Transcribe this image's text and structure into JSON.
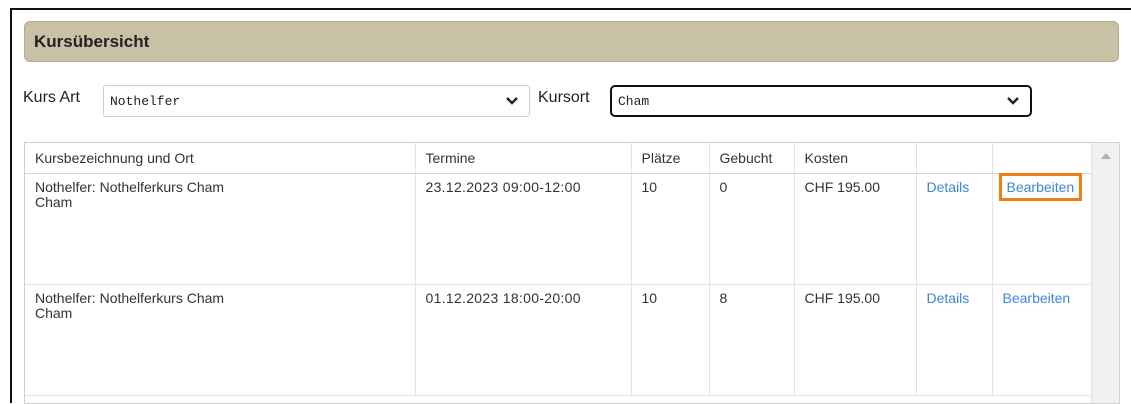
{
  "panel": {
    "title": "Kursübersicht"
  },
  "filters": {
    "kursart_label": "Kurs Art",
    "kursart_value": "Nothelfer",
    "kursort_label": "Kursort",
    "kursort_value": "Cham"
  },
  "table": {
    "headers": [
      "Kursbezeichnung und Ort",
      "Termine",
      "Plätze",
      "Gebucht",
      "Kosten",
      "",
      ""
    ],
    "rows": [
      {
        "name": "Nothelfer: Nothelferkurs Cham",
        "place": "Cham",
        "termin": "23.12.2023 09:00-12:00",
        "plaetze": "10",
        "gebucht": "0",
        "kosten": "CHF 195.00",
        "details": "Details",
        "edit": "Bearbeiten"
      },
      {
        "name": "Nothelfer: Nothelferkurs Cham",
        "place": "Cham",
        "termin": "01.12.2023 18:00-20:00",
        "plaetze": "10",
        "gebucht": "8",
        "kosten": "CHF 195.00",
        "details": "Details",
        "edit": "Bearbeiten"
      }
    ]
  },
  "colors": {
    "header_bg": "#c9c1a6",
    "link": "#3b86d8",
    "highlight": "#f0800f"
  }
}
